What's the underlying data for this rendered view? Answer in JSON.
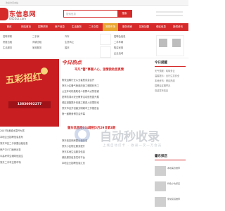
{
  "topbar": {
    "message": "欢迎访问本站"
  },
  "header": {
    "site_name": "东信息网",
    "url": "0455sz.com",
    "search_placeholder": "搜索信息",
    "search_button": "搜索"
  },
  "nav": [
    "首页",
    "网站首页",
    "招聘求职",
    "房产信息",
    "生活服务",
    "二手交易",
    "宠物市场",
    "服务商家",
    "招商加盟",
    "便民信息",
    "新闻资讯"
  ],
  "nav_hot_index": 6,
  "subnav": {
    "col1": [
      "招聘求职",
      "房屋出租",
      "生活服务"
    ],
    "col2": [
      "二手房",
      "商铺出租",
      "家政服务"
    ],
    "col3": [
      "汽车",
      "生意转让",
      "婚庆"
    ],
    "side": [
      "招聘会信息",
      "二手车网",
      "购买优惠",
      "企业活动",
      "招商信息"
    ]
  },
  "banner": {
    "title": "五彩招红",
    "phone": "13836002277"
  },
  "panel": {
    "jinri": "今日热点",
    "headline": "平凡“警”事暖人心，温情救助显真情",
    "news1": [
      "物流运输行业从业者座谈会召开",
      "肇东小区暖气管道改造工程顺利完工",
      "公交车司机救助老人获群众点赞感谢",
      "夏季防溺水安全教育活动进校园开展",
      "城区道路提升改造工程进入收尾阶段",
      "肇东市召开创建文明城市工作推进会",
      "第一届粮食博览会开幕"
    ],
    "headline2": "肇东信息网034期招5月29日第3期",
    "news2": [
      "肇东信息网房屋出租信息",
      "肇东小区物业服务提升",
      "肇东本地生活服务信息",
      "便民服务信息发布平台",
      "本地企业招聘信息汇总"
    ]
  },
  "rightcol": {
    "title": "今日提醒",
    "lines": [
      "天气预报：晴转多云",
      "温馨提示：出行注意安全",
      "本地资讯：便民热线",
      "招聘会定期举办",
      "欢迎发布信息"
    ],
    "title2": "肇东探店",
    "items": [
      "本地美食推荐",
      "特色小吃探店",
      "家常菜馆推荐"
    ]
  },
  "leftlist": [
    "2007年诸城冰雪杯大赛",
    "本地企业招聘信息发布",
    "肇东市区二手房屋出租信息",
    "房产中介门面房出售",
    "中高考学生辅导班招生",
    "肇东二手车交易市场"
  ],
  "watermark": {
    "text": "自动秒收录",
    "sub": "上线自动打卡 · 收录一次一万会员"
  }
}
